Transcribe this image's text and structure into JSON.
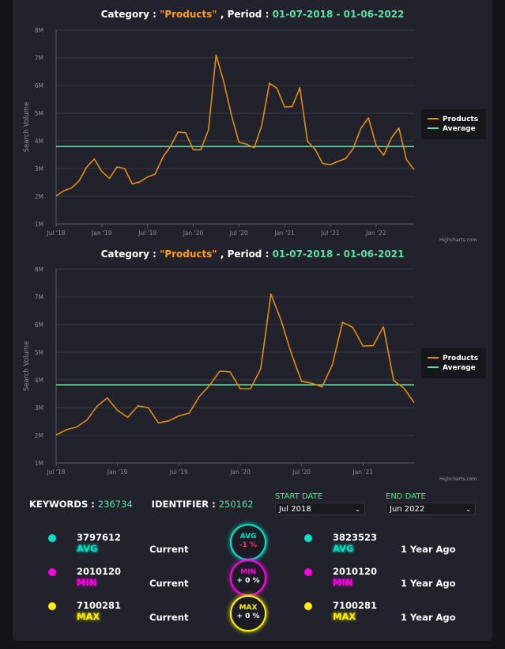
{
  "charts": [
    {
      "title": {
        "prefix": "Category : ",
        "category": "\"Products\"",
        "mid": " , Period : ",
        "period": "01-07-2018 - 01-06-2022"
      },
      "chart_data": {
        "type": "line",
        "ylabel": "Search Volume",
        "ylim": [
          1000000,
          8000000
        ],
        "yticks": [
          {
            "v": 1000000,
            "t": "1M"
          },
          {
            "v": 2000000,
            "t": "2M"
          },
          {
            "v": 3000000,
            "t": "3M"
          },
          {
            "v": 4000000,
            "t": "4M"
          },
          {
            "v": 5000000,
            "t": "5M"
          },
          {
            "v": 6000000,
            "t": "6M"
          },
          {
            "v": 7000000,
            "t": "7M"
          },
          {
            "v": 8000000,
            "t": "8M"
          }
        ],
        "xticks": [
          {
            "i": 0,
            "t": "Jul '18"
          },
          {
            "i": 6,
            "t": "Jan '19"
          },
          {
            "i": 12,
            "t": "Jul '19"
          },
          {
            "i": 18,
            "t": "Jan '20"
          },
          {
            "i": 24,
            "t": "Jul '20"
          },
          {
            "i": 30,
            "t": "Jan '21"
          },
          {
            "i": 36,
            "t": "Jul '21"
          },
          {
            "i": 42,
            "t": "Jan '22"
          }
        ],
        "n_points": 48,
        "grid": true,
        "legend": "right",
        "series": [
          {
            "name": "Products",
            "color": "#e08e0b",
            "values": [
              2010120,
              2200000,
              2300000,
              2550000,
              3050000,
              3350000,
              2900000,
              2650000,
              3060000,
              3000000,
              2450000,
              2520000,
              2700000,
              2800000,
              3400000,
              3800000,
              4320000,
              4290000,
              3680000,
              3680000,
              4400000,
              7100281,
              6150000,
              4950000,
              3950000,
              3880000,
              3750000,
              4550000,
              6080000,
              5900000,
              5220000,
              5240000,
              5920000,
              3980000,
              3700000,
              3180000,
              3140000,
              3260000,
              3360000,
              3720000,
              4450000,
              4830000,
              3850000,
              3480000,
              4100000,
              4470000,
              3320000,
              2960000
            ]
          },
          {
            "name": "Average",
            "color": "#5ee0a6",
            "values": [
              3797612,
              3797612,
              3797612,
              3797612,
              3797612,
              3797612,
              3797612,
              3797612,
              3797612,
              3797612,
              3797612,
              3797612,
              3797612,
              3797612,
              3797612,
              3797612,
              3797612,
              3797612,
              3797612,
              3797612,
              3797612,
              3797612,
              3797612,
              3797612,
              3797612,
              3797612,
              3797612,
              3797612,
              3797612,
              3797612,
              3797612,
              3797612,
              3797612,
              3797612,
              3797612,
              3797612,
              3797612,
              3797612,
              3797612,
              3797612,
              3797612,
              3797612,
              3797612,
              3797612,
              3797612,
              3797612,
              3797612,
              3797612
            ]
          }
        ]
      },
      "credit": "Highcharts.com"
    },
    {
      "title": {
        "prefix": "Category : ",
        "category": "\"Products\"",
        "mid": " , Period : ",
        "period": "01-07-2018 - 01-06-2021"
      },
      "chart_data": {
        "type": "line",
        "ylabel": "Search Volume",
        "ylim": [
          1000000,
          8000000
        ],
        "yticks": [
          {
            "v": 1000000,
            "t": "1M"
          },
          {
            "v": 2000000,
            "t": "2M"
          },
          {
            "v": 3000000,
            "t": "3M"
          },
          {
            "v": 4000000,
            "t": "4M"
          },
          {
            "v": 5000000,
            "t": "5M"
          },
          {
            "v": 6000000,
            "t": "6M"
          },
          {
            "v": 7000000,
            "t": "7M"
          },
          {
            "v": 8000000,
            "t": "8M"
          }
        ],
        "xticks": [
          {
            "i": 0,
            "t": "Jul '18"
          },
          {
            "i": 6,
            "t": "Jan '19"
          },
          {
            "i": 12,
            "t": "Jul '19"
          },
          {
            "i": 18,
            "t": "Jan '20"
          },
          {
            "i": 24,
            "t": "Jul '20"
          },
          {
            "i": 30,
            "t": "Jan '21"
          }
        ],
        "n_points": 36,
        "grid": true,
        "legend": "right",
        "series": [
          {
            "name": "Products",
            "color": "#e08e0b",
            "values": [
              2010120,
              2200000,
              2300000,
              2550000,
              3050000,
              3350000,
              2900000,
              2650000,
              3060000,
              3000000,
              2450000,
              2520000,
              2700000,
              2800000,
              3400000,
              3800000,
              4320000,
              4290000,
              3680000,
              3680000,
              4400000,
              7100281,
              6150000,
              4950000,
              3950000,
              3880000,
              3750000,
              4550000,
              6080000,
              5900000,
              5220000,
              5240000,
              5920000,
              3980000,
              3700000,
              3180000
            ]
          },
          {
            "name": "Average",
            "color": "#5ee0a6",
            "values": [
              3823523,
              3823523,
              3823523,
              3823523,
              3823523,
              3823523,
              3823523,
              3823523,
              3823523,
              3823523,
              3823523,
              3823523,
              3823523,
              3823523,
              3823523,
              3823523,
              3823523,
              3823523,
              3823523,
              3823523,
              3823523,
              3823523,
              3823523,
              3823523,
              3823523,
              3823523,
              3823523,
              3823523,
              3823523,
              3823523,
              3823523,
              3823523,
              3823523,
              3823523,
              3823523,
              3823523
            ]
          }
        ]
      },
      "credit": "Highcharts.com"
    }
  ],
  "stats": {
    "keywords_label": "KEYWORDS :",
    "keywords_value": "236734",
    "identifier_label": "IDENTIFIER :",
    "identifier_value": "250162"
  },
  "dates": {
    "start_label": "START DATE",
    "start_value": "Jul 2018",
    "end_label": "END DATE",
    "end_value": "Jun 2022"
  },
  "metrics": [
    {
      "key": "avg",
      "label": "AVG",
      "color": "#00e5c8",
      "current_value": "3797612",
      "current_period": "Current",
      "past_value": "3823523",
      "past_period": "1 Year Ago",
      "badge_label": "AVG",
      "badge_change": "-1 %",
      "badge_change_color": "#ff2d6f"
    },
    {
      "key": "min",
      "label": "MIN",
      "color": "#ff00e6",
      "current_value": "2010120",
      "current_period": "Current",
      "past_value": "2010120",
      "past_period": "1 Year Ago",
      "badge_label": "MIN",
      "badge_change": "+ 0 %",
      "badge_change_color": "#ffffff"
    },
    {
      "key": "max",
      "label": "MAX",
      "color": "#ffee00",
      "current_value": "7100281",
      "current_period": "Current",
      "past_value": "7100281",
      "past_period": "1 Year Ago",
      "badge_label": "MAX",
      "badge_change": "+ 0 %",
      "badge_change_color": "#ffffff"
    }
  ]
}
